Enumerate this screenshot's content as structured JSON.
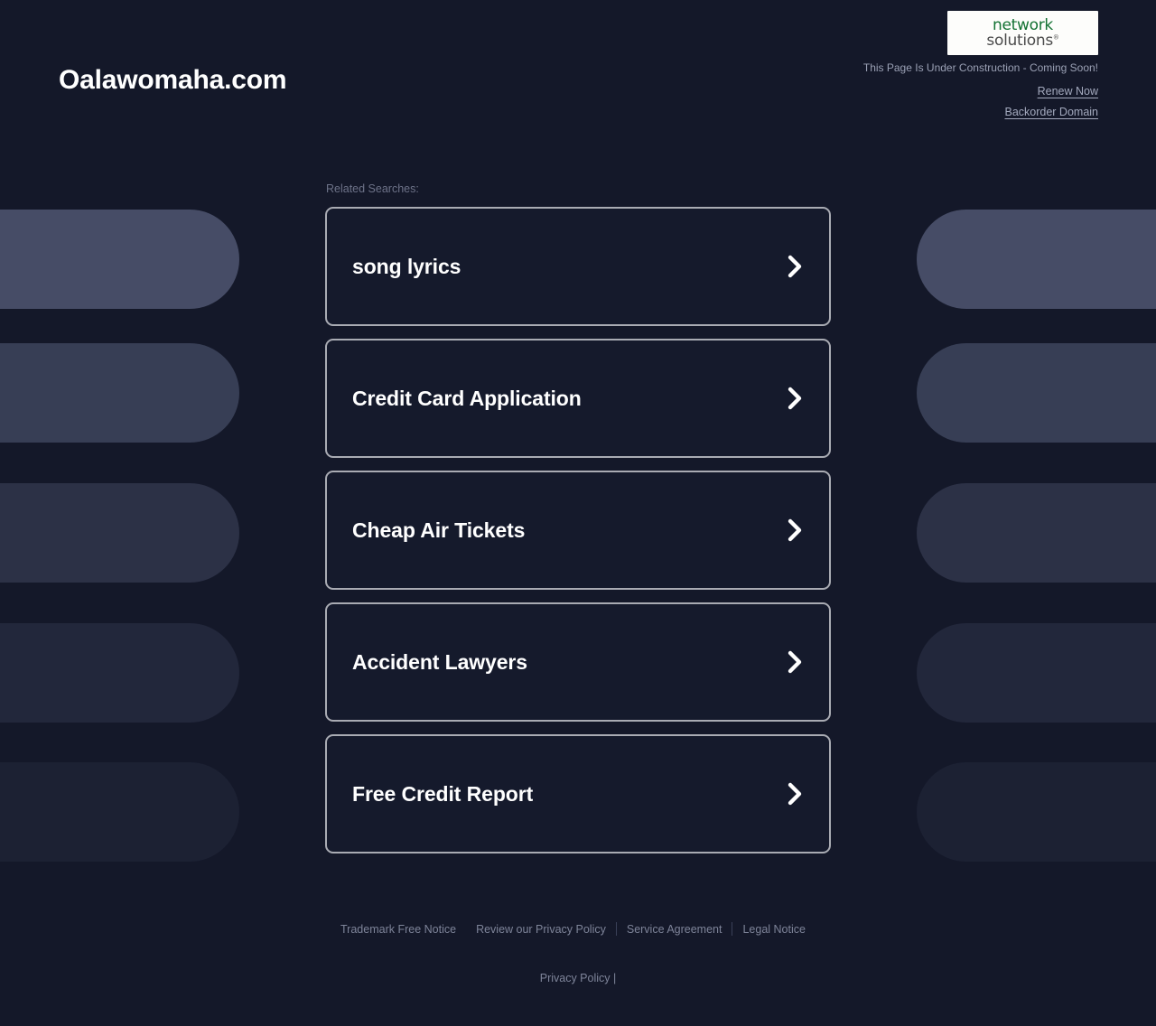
{
  "page": {
    "background_color": "#141829",
    "title": "Oalawomaha.com"
  },
  "header": {
    "site_title": "Oalawomaha.com",
    "logo": {
      "name": "network-solutions-logo",
      "line1": "network",
      "line2": "solutions",
      "registered_mark": "®",
      "line1_color": "#127132",
      "line2_color": "#4b4b4b",
      "background_color": "#fdfdfb"
    },
    "notice": "This Page Is Under Construction - Coming Soon!",
    "links": [
      {
        "label": "Renew Now"
      },
      {
        "label": "Backorder Domain"
      }
    ]
  },
  "main": {
    "related_label": "Related Searches:",
    "cards": [
      {
        "label": "song lyrics",
        "icon": "chevron-right-icon"
      },
      {
        "label": "Credit Card Application",
        "icon": "chevron-right-icon"
      },
      {
        "label": "Cheap Air Tickets",
        "icon": "chevron-right-icon"
      },
      {
        "label": "Accident Lawyers",
        "icon": "chevron-right-icon"
      },
      {
        "label": "Free Credit Report",
        "icon": "chevron-right-icon"
      }
    ]
  },
  "footer": {
    "links": [
      {
        "label": "Trademark Free Notice",
        "separator_after": false
      },
      {
        "label": "Review our Privacy Policy",
        "separator_after": true
      },
      {
        "label": "Service Agreement",
        "separator_after": true
      },
      {
        "label": "Legal Notice",
        "separator_after": false
      }
    ],
    "bottom_text": "Privacy Policy |"
  },
  "decoration": {
    "pill_color": "#8c97bd",
    "rows": [
      {
        "opacity": 0.42
      },
      {
        "opacity": 0.3
      },
      {
        "opacity": 0.2
      },
      {
        "opacity": 0.12
      },
      {
        "opacity": 0.075
      }
    ]
  }
}
